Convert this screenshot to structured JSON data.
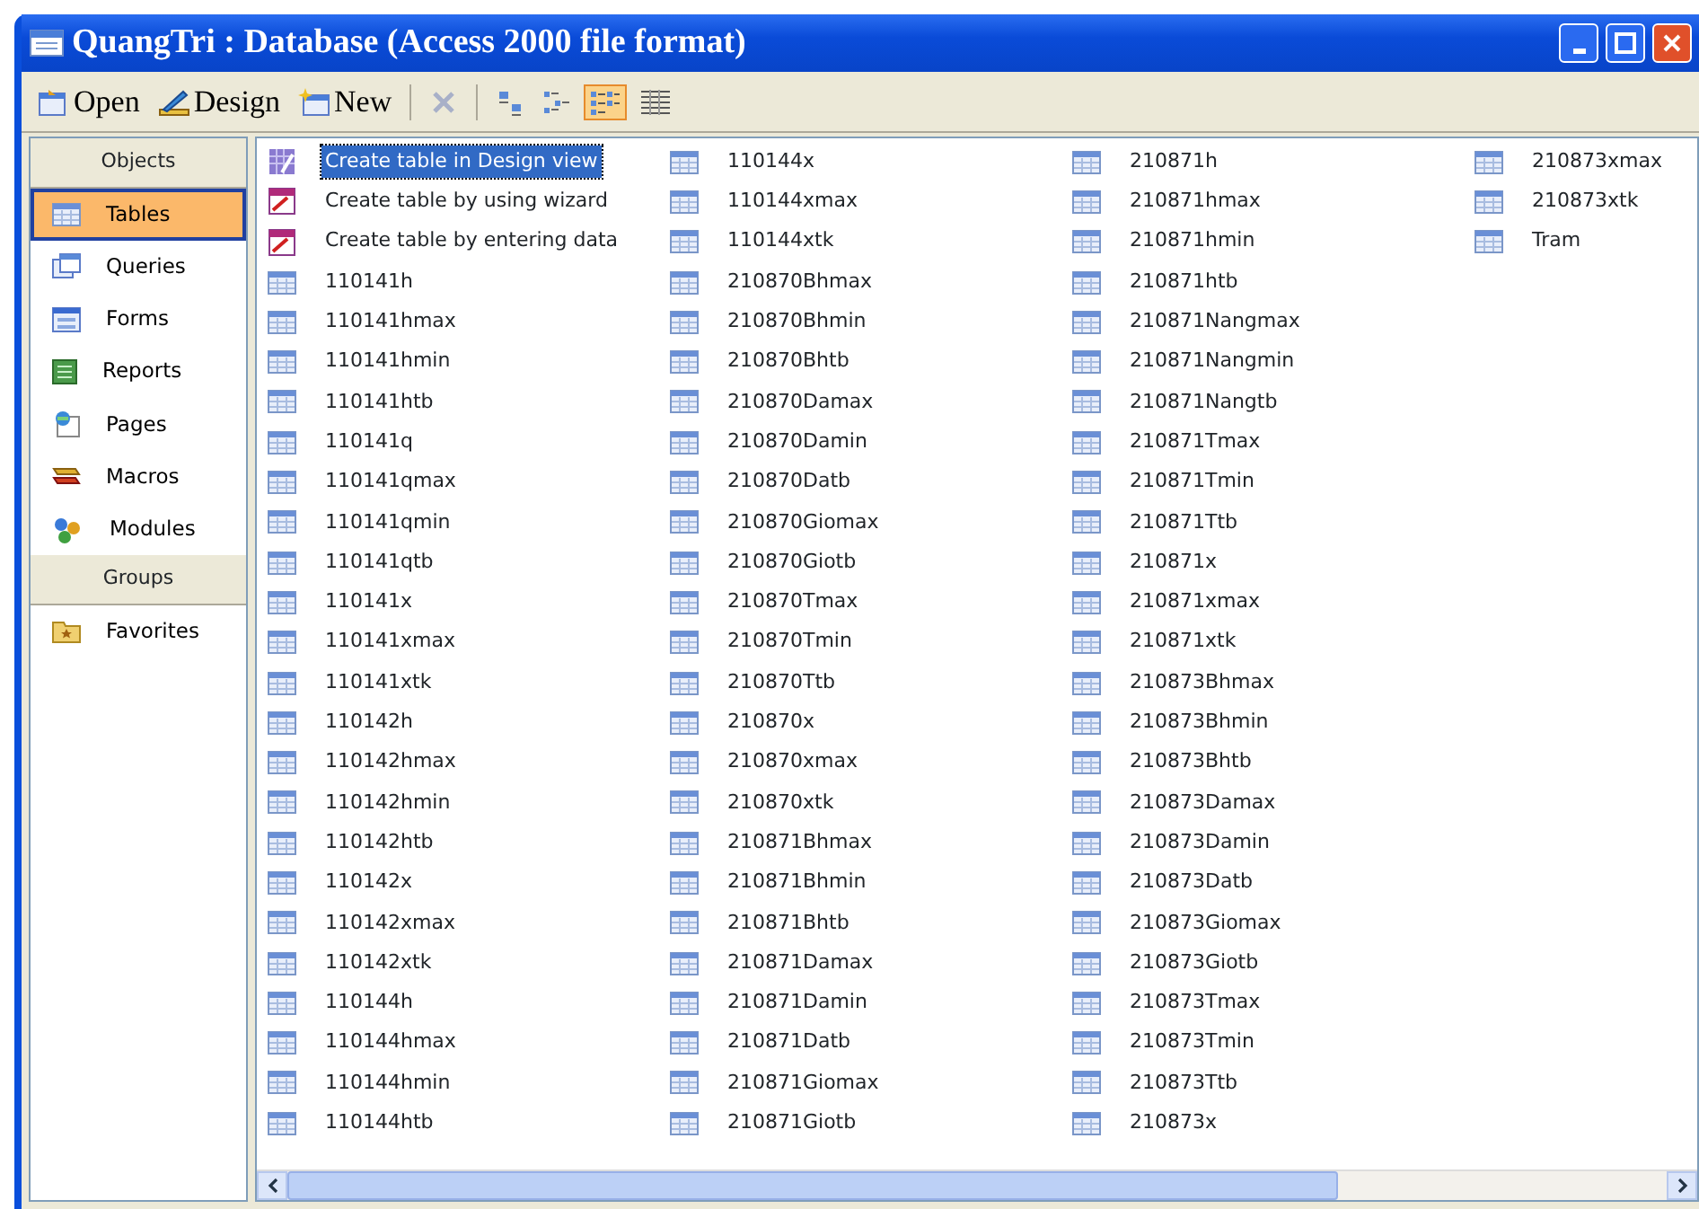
{
  "window": {
    "title": "QuangTri : Database (Access 2000 file format)"
  },
  "toolbar": [
    {
      "kind": "open",
      "label": "Open"
    },
    {
      "kind": "design",
      "label": "Design"
    },
    {
      "kind": "new",
      "label": "New"
    },
    {
      "kind": "delete",
      "disabled": true
    },
    {
      "kind": "largeicons",
      "selected": false
    },
    {
      "kind": "smallicons",
      "selected": false
    },
    {
      "kind": "list",
      "selected": true
    },
    {
      "kind": "details",
      "selected": false
    }
  ],
  "sidebar": {
    "sections": [
      {
        "label": "Objects",
        "items": [
          {
            "kind": "tables",
            "label": "Tables",
            "selected": true
          },
          {
            "kind": "queries",
            "label": "Queries",
            "selected": false
          },
          {
            "kind": "forms",
            "label": "Forms",
            "selected": false
          },
          {
            "kind": "reports",
            "label": "Reports",
            "selected": false
          },
          {
            "kind": "pages",
            "label": "Pages",
            "selected": false
          },
          {
            "kind": "macros",
            "label": "Macros",
            "selected": false
          },
          {
            "kind": "modules",
            "label": "Modules",
            "selected": false
          }
        ]
      },
      {
        "label": "Groups",
        "items": [
          {
            "kind": "favorites",
            "label": "Favorites",
            "selected": false
          }
        ]
      }
    ]
  },
  "list": {
    "items": [
      {
        "kind": "design",
        "label": "Create table in Design view",
        "selected": true
      },
      {
        "kind": "wizard",
        "label": "Create table by using wizard",
        "selected": false
      },
      {
        "kind": "wizard",
        "label": "Create table by entering data",
        "selected": false
      },
      {
        "kind": "table",
        "label": "110141h",
        "selected": false
      },
      {
        "kind": "table",
        "label": "110141hmax",
        "selected": false
      },
      {
        "kind": "table",
        "label": "110141hmin",
        "selected": false
      },
      {
        "kind": "table",
        "label": "110141htb",
        "selected": false
      },
      {
        "kind": "table",
        "label": "110141q",
        "selected": false
      },
      {
        "kind": "table",
        "label": "110141qmax",
        "selected": false
      },
      {
        "kind": "table",
        "label": "110141qmin",
        "selected": false
      },
      {
        "kind": "table",
        "label": "110141qtb",
        "selected": false
      },
      {
        "kind": "table",
        "label": "110141x",
        "selected": false
      },
      {
        "kind": "table",
        "label": "110141xmax",
        "selected": false
      },
      {
        "kind": "table",
        "label": "110141xtk",
        "selected": false
      },
      {
        "kind": "table",
        "label": "110142h",
        "selected": false
      },
      {
        "kind": "table",
        "label": "110142hmax",
        "selected": false
      },
      {
        "kind": "table",
        "label": "110142hmin",
        "selected": false
      },
      {
        "kind": "table",
        "label": "110142htb",
        "selected": false
      },
      {
        "kind": "table",
        "label": "110142x",
        "selected": false
      },
      {
        "kind": "table",
        "label": "110142xmax",
        "selected": false
      },
      {
        "kind": "table",
        "label": "110142xtk",
        "selected": false
      },
      {
        "kind": "table",
        "label": "110144h",
        "selected": false
      },
      {
        "kind": "table",
        "label": "110144hmax",
        "selected": false
      },
      {
        "kind": "table",
        "label": "110144hmin",
        "selected": false
      },
      {
        "kind": "table",
        "label": "110144htb",
        "selected": false
      },
      {
        "kind": "table",
        "label": "110144x",
        "selected": false
      },
      {
        "kind": "table",
        "label": "110144xmax",
        "selected": false
      },
      {
        "kind": "table",
        "label": "110144xtk",
        "selected": false
      },
      {
        "kind": "table",
        "label": "210870Bhmax",
        "selected": false
      },
      {
        "kind": "table",
        "label": "210870Bhmin",
        "selected": false
      },
      {
        "kind": "table",
        "label": "210870Bhtb",
        "selected": false
      },
      {
        "kind": "table",
        "label": "210870Damax",
        "selected": false
      },
      {
        "kind": "table",
        "label": "210870Damin",
        "selected": false
      },
      {
        "kind": "table",
        "label": "210870Datb",
        "selected": false
      },
      {
        "kind": "table",
        "label": "210870Giomax",
        "selected": false
      },
      {
        "kind": "table",
        "label": "210870Giotb",
        "selected": false
      },
      {
        "kind": "table",
        "label": "210870Tmax",
        "selected": false
      },
      {
        "kind": "table",
        "label": "210870Tmin",
        "selected": false
      },
      {
        "kind": "table",
        "label": "210870Ttb",
        "selected": false
      },
      {
        "kind": "table",
        "label": "210870x",
        "selected": false
      },
      {
        "kind": "table",
        "label": "210870xmax",
        "selected": false
      },
      {
        "kind": "table",
        "label": "210870xtk",
        "selected": false
      },
      {
        "kind": "table",
        "label": "210871Bhmax",
        "selected": false
      },
      {
        "kind": "table",
        "label": "210871Bhmin",
        "selected": false
      },
      {
        "kind": "table",
        "label": "210871Bhtb",
        "selected": false
      },
      {
        "kind": "table",
        "label": "210871Damax",
        "selected": false
      },
      {
        "kind": "table",
        "label": "210871Damin",
        "selected": false
      },
      {
        "kind": "table",
        "label": "210871Datb",
        "selected": false
      },
      {
        "kind": "table",
        "label": "210871Giomax",
        "selected": false
      },
      {
        "kind": "table",
        "label": "210871Giotb",
        "selected": false
      },
      {
        "kind": "table",
        "label": "210871h",
        "selected": false
      },
      {
        "kind": "table",
        "label": "210871hmax",
        "selected": false
      },
      {
        "kind": "table",
        "label": "210871hmin",
        "selected": false
      },
      {
        "kind": "table",
        "label": "210871htb",
        "selected": false
      },
      {
        "kind": "table",
        "label": "210871Nangmax",
        "selected": false
      },
      {
        "kind": "table",
        "label": "210871Nangmin",
        "selected": false
      },
      {
        "kind": "table",
        "label": "210871Nangtb",
        "selected": false
      },
      {
        "kind": "table",
        "label": "210871Tmax",
        "selected": false
      },
      {
        "kind": "table",
        "label": "210871Tmin",
        "selected": false
      },
      {
        "kind": "table",
        "label": "210871Ttb",
        "selected": false
      },
      {
        "kind": "table",
        "label": "210871x",
        "selected": false
      },
      {
        "kind": "table",
        "label": "210871xmax",
        "selected": false
      },
      {
        "kind": "table",
        "label": "210871xtk",
        "selected": false
      },
      {
        "kind": "table",
        "label": "210873Bhmax",
        "selected": false
      },
      {
        "kind": "table",
        "label": "210873Bhmin",
        "selected": false
      },
      {
        "kind": "table",
        "label": "210873Bhtb",
        "selected": false
      },
      {
        "kind": "table",
        "label": "210873Damax",
        "selected": false
      },
      {
        "kind": "table",
        "label": "210873Damin",
        "selected": false
      },
      {
        "kind": "table",
        "label": "210873Datb",
        "selected": false
      },
      {
        "kind": "table",
        "label": "210873Giomax",
        "selected": false
      },
      {
        "kind": "table",
        "label": "210873Giotb",
        "selected": false
      },
      {
        "kind": "table",
        "label": "210873Tmax",
        "selected": false
      },
      {
        "kind": "table",
        "label": "210873Tmin",
        "selected": false
      },
      {
        "kind": "table",
        "label": "210873Ttb",
        "selected": false
      },
      {
        "kind": "table",
        "label": "210873x",
        "selected": false
      },
      {
        "kind": "table",
        "label": "210873xmax",
        "selected": false
      },
      {
        "kind": "table",
        "label": "210873xtk",
        "selected": false
      },
      {
        "kind": "table",
        "label": "Tram",
        "selected": false
      }
    ]
  }
}
